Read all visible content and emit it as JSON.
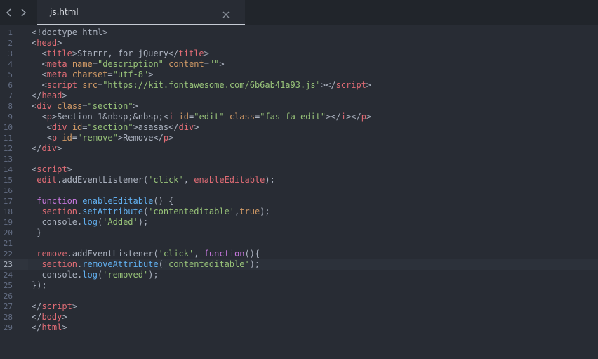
{
  "tab": {
    "title": "js.html"
  },
  "navigation": {
    "back_icon": "chevron-left-icon",
    "forward_icon": "chevron-right-icon",
    "close_icon": "close-icon"
  },
  "colors": {
    "background": "#282c34",
    "tabbar": "#21252b",
    "line_number": "#636d83",
    "tag": "#e06c75",
    "attribute": "#d19a66",
    "string": "#98c379",
    "keyword": "#c678dd",
    "function": "#61afef"
  },
  "editor": {
    "active_line": 23,
    "lines": [
      {
        "n": "1",
        "tokens": [
          {
            "t": "<!doctype html>",
            "c": "pl"
          }
        ]
      },
      {
        "n": "2",
        "tokens": [
          {
            "t": "<",
            "c": "pl"
          },
          {
            "t": "head",
            "c": "tag"
          },
          {
            "t": ">",
            "c": "pl"
          }
        ]
      },
      {
        "n": "3",
        "tokens": [
          {
            "t": "  <",
            "c": "pl"
          },
          {
            "t": "title",
            "c": "tag"
          },
          {
            "t": ">Starrr, for jQuery</",
            "c": "pl"
          },
          {
            "t": "title",
            "c": "tag"
          },
          {
            "t": ">",
            "c": "pl"
          }
        ]
      },
      {
        "n": "4",
        "tokens": [
          {
            "t": "  <",
            "c": "pl"
          },
          {
            "t": "meta",
            "c": "tag"
          },
          {
            "t": " ",
            "c": "pl"
          },
          {
            "t": "name",
            "c": "attr"
          },
          {
            "t": "=",
            "c": "pl"
          },
          {
            "t": "\"description\"",
            "c": "str"
          },
          {
            "t": " ",
            "c": "pl"
          },
          {
            "t": "content",
            "c": "attr"
          },
          {
            "t": "=",
            "c": "pl"
          },
          {
            "t": "\"\"",
            "c": "str"
          },
          {
            "t": ">",
            "c": "pl"
          }
        ]
      },
      {
        "n": "5",
        "tokens": [
          {
            "t": "  <",
            "c": "pl"
          },
          {
            "t": "meta",
            "c": "tag"
          },
          {
            "t": " ",
            "c": "pl"
          },
          {
            "t": "charset",
            "c": "attr"
          },
          {
            "t": "=",
            "c": "pl"
          },
          {
            "t": "\"utf-8\"",
            "c": "str"
          },
          {
            "t": ">",
            "c": "pl"
          }
        ]
      },
      {
        "n": "6",
        "tokens": [
          {
            "t": "  <",
            "c": "pl"
          },
          {
            "t": "script",
            "c": "tag"
          },
          {
            "t": " ",
            "c": "pl"
          },
          {
            "t": "src",
            "c": "attr"
          },
          {
            "t": "=",
            "c": "pl"
          },
          {
            "t": "\"https://kit.fontawesome.com/6b6ab41a93.js\"",
            "c": "str"
          },
          {
            "t": "></",
            "c": "pl"
          },
          {
            "t": "script",
            "c": "tag"
          },
          {
            "t": ">",
            "c": "pl"
          }
        ]
      },
      {
        "n": "7",
        "tokens": [
          {
            "t": "</",
            "c": "pl"
          },
          {
            "t": "head",
            "c": "tag"
          },
          {
            "t": ">",
            "c": "pl"
          }
        ]
      },
      {
        "n": "8",
        "tokens": [
          {
            "t": "<",
            "c": "pl"
          },
          {
            "t": "div",
            "c": "tag"
          },
          {
            "t": " ",
            "c": "pl"
          },
          {
            "t": "class",
            "c": "attr"
          },
          {
            "t": "=",
            "c": "pl"
          },
          {
            "t": "\"section\"",
            "c": "str"
          },
          {
            "t": ">",
            "c": "pl"
          }
        ]
      },
      {
        "n": "9",
        "tokens": [
          {
            "t": "  <",
            "c": "pl"
          },
          {
            "t": "p",
            "c": "tag"
          },
          {
            "t": ">Section 1",
            "c": "pl"
          },
          {
            "t": "&nbsp;&nbsp;",
            "c": "pl"
          },
          {
            "t": "<",
            "c": "pl"
          },
          {
            "t": "i",
            "c": "tag"
          },
          {
            "t": " ",
            "c": "pl"
          },
          {
            "t": "id",
            "c": "attr"
          },
          {
            "t": "=",
            "c": "pl"
          },
          {
            "t": "\"edit\"",
            "c": "str"
          },
          {
            "t": " ",
            "c": "pl"
          },
          {
            "t": "class",
            "c": "attr"
          },
          {
            "t": "=",
            "c": "pl"
          },
          {
            "t": "\"fas fa-edit\"",
            "c": "str"
          },
          {
            "t": "></",
            "c": "pl"
          },
          {
            "t": "i",
            "c": "tag"
          },
          {
            "t": "></",
            "c": "pl"
          },
          {
            "t": "p",
            "c": "tag"
          },
          {
            "t": ">",
            "c": "pl"
          }
        ]
      },
      {
        "n": "10",
        "tokens": [
          {
            "t": "   <",
            "c": "pl"
          },
          {
            "t": "div",
            "c": "tag"
          },
          {
            "t": " ",
            "c": "pl"
          },
          {
            "t": "id",
            "c": "attr"
          },
          {
            "t": "=",
            "c": "pl"
          },
          {
            "t": "\"section\"",
            "c": "str"
          },
          {
            "t": ">asasas</",
            "c": "pl"
          },
          {
            "t": "div",
            "c": "tag"
          },
          {
            "t": ">",
            "c": "pl"
          }
        ]
      },
      {
        "n": "11",
        "tokens": [
          {
            "t": "   <",
            "c": "pl"
          },
          {
            "t": "p",
            "c": "tag"
          },
          {
            "t": " ",
            "c": "pl"
          },
          {
            "t": "id",
            "c": "attr"
          },
          {
            "t": "=",
            "c": "pl"
          },
          {
            "t": "\"remove\"",
            "c": "str"
          },
          {
            "t": ">Remove</",
            "c": "pl"
          },
          {
            "t": "p",
            "c": "tag"
          },
          {
            "t": ">",
            "c": "pl"
          }
        ]
      },
      {
        "n": "12",
        "tokens": [
          {
            "t": "</",
            "c": "pl"
          },
          {
            "t": "div",
            "c": "tag"
          },
          {
            "t": ">",
            "c": "pl"
          }
        ]
      },
      {
        "n": "13",
        "tokens": []
      },
      {
        "n": "14",
        "tokens": [
          {
            "t": "<",
            "c": "pl"
          },
          {
            "t": "script",
            "c": "tag"
          },
          {
            "t": ">",
            "c": "pl"
          }
        ]
      },
      {
        "n": "15",
        "tokens": [
          {
            "t": " ",
            "c": "pl"
          },
          {
            "t": "edit",
            "c": "var"
          },
          {
            "t": ".addEventListener(",
            "c": "pl"
          },
          {
            "t": "'click'",
            "c": "str"
          },
          {
            "t": ", ",
            "c": "pl"
          },
          {
            "t": "enableEditable",
            "c": "var"
          },
          {
            "t": ");",
            "c": "pl"
          }
        ]
      },
      {
        "n": "16",
        "tokens": []
      },
      {
        "n": "17",
        "tokens": [
          {
            "t": " ",
            "c": "pl"
          },
          {
            "t": "function",
            "c": "kw"
          },
          {
            "t": " ",
            "c": "pl"
          },
          {
            "t": "enableEditable",
            "c": "fn"
          },
          {
            "t": "() {",
            "c": "pl"
          }
        ]
      },
      {
        "n": "18",
        "tokens": [
          {
            "t": "  ",
            "c": "pl"
          },
          {
            "t": "section",
            "c": "var"
          },
          {
            "t": ".",
            "c": "pl"
          },
          {
            "t": "setAttribute",
            "c": "fn"
          },
          {
            "t": "(",
            "c": "pl"
          },
          {
            "t": "'contenteditable'",
            "c": "str"
          },
          {
            "t": ",",
            "c": "pl"
          },
          {
            "t": "true",
            "c": "attr"
          },
          {
            "t": ");",
            "c": "pl"
          }
        ]
      },
      {
        "n": "19",
        "tokens": [
          {
            "t": "  console.",
            "c": "pl"
          },
          {
            "t": "log",
            "c": "fn"
          },
          {
            "t": "(",
            "c": "pl"
          },
          {
            "t": "'Added'",
            "c": "str"
          },
          {
            "t": ");",
            "c": "pl"
          }
        ]
      },
      {
        "n": "20",
        "tokens": [
          {
            "t": " }",
            "c": "pl"
          }
        ]
      },
      {
        "n": "21",
        "tokens": []
      },
      {
        "n": "22",
        "tokens": [
          {
            "t": " ",
            "c": "pl"
          },
          {
            "t": "remove",
            "c": "var"
          },
          {
            "t": ".addEventListener(",
            "c": "pl"
          },
          {
            "t": "'click'",
            "c": "str"
          },
          {
            "t": ", ",
            "c": "pl"
          },
          {
            "t": "function",
            "c": "kw"
          },
          {
            "t": "(){",
            "c": "pl"
          }
        ]
      },
      {
        "n": "23",
        "tokens": [
          {
            "t": "  ",
            "c": "pl"
          },
          {
            "t": "section",
            "c": "var"
          },
          {
            "t": ".",
            "c": "pl"
          },
          {
            "t": "removeAttribute",
            "c": "fn"
          },
          {
            "t": "(",
            "c": "pl"
          },
          {
            "t": "'contenteditable'",
            "c": "str"
          },
          {
            "t": ");",
            "c": "pl"
          }
        ]
      },
      {
        "n": "24",
        "tokens": [
          {
            "t": "  console.",
            "c": "pl"
          },
          {
            "t": "log",
            "c": "fn"
          },
          {
            "t": "(",
            "c": "pl"
          },
          {
            "t": "'removed'",
            "c": "str"
          },
          {
            "t": ");",
            "c": "pl"
          }
        ]
      },
      {
        "n": "25",
        "tokens": [
          {
            "t": "});",
            "c": "pl"
          }
        ]
      },
      {
        "n": "26",
        "tokens": []
      },
      {
        "n": "27",
        "tokens": [
          {
            "t": "</",
            "c": "pl"
          },
          {
            "t": "script",
            "c": "tag"
          },
          {
            "t": ">",
            "c": "pl"
          }
        ]
      },
      {
        "n": "28",
        "tokens": [
          {
            "t": "</",
            "c": "pl"
          },
          {
            "t": "body",
            "c": "tag"
          },
          {
            "t": ">",
            "c": "pl"
          }
        ]
      },
      {
        "n": "29",
        "tokens": [
          {
            "t": "</",
            "c": "pl"
          },
          {
            "t": "html",
            "c": "tag"
          },
          {
            "t": ">",
            "c": "pl"
          }
        ]
      }
    ]
  }
}
